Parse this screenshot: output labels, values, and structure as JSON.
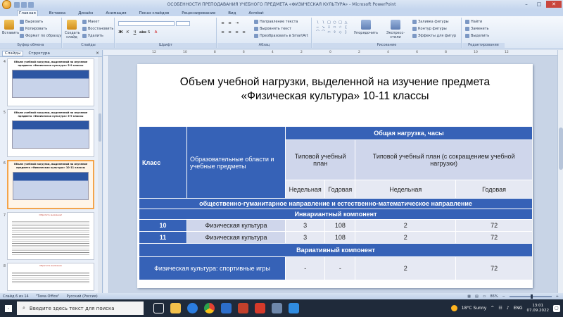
{
  "window": {
    "title": "ОСОБЕННОСТИ ПРЕПОДАВАНИЯ УЧЕБНОГО ПРЕДМЕТА «ФИЗИЧЕСКАЯ КУЛЬТУРА» - Microsoft PowerPoint"
  },
  "ribbon_tabs": [
    "Главная",
    "Вставка",
    "Дизайн",
    "Анимация",
    "Показ слайдов",
    "Рецензирование",
    "Вид",
    "Acrobat"
  ],
  "ribbon": {
    "clipboard": {
      "paste": "Вставить",
      "cut": "Вырезать",
      "copy": "Копировать",
      "format_painter": "Формат по образцу",
      "label": "Буфер обмена"
    },
    "slides": {
      "create": "Создать слайд",
      "layout": "Макет",
      "restore": "Восстановить",
      "delete": "Удалить",
      "label": "Слайды"
    },
    "font": {
      "label": "Шрифт"
    },
    "paragraph": {
      "text_direction": "Направление текста",
      "align_text": "Выровнять текст",
      "smartart": "Преобразовать в SmartArt",
      "label": "Абзац"
    },
    "drawing": {
      "arrange": "Упорядочить",
      "quick_styles": "Экспресс-стили",
      "fill": "Заливка фигуры",
      "outline": "Контур фигуры",
      "effects": "Эффекты для фигур",
      "label": "Рисование"
    },
    "editing": {
      "find": "Найти",
      "replace": "Заменить",
      "select": "Выделить",
      "label": "Редактирование"
    }
  },
  "left_panel": {
    "tab_slides": "Слайды",
    "tab_outline": "Структура",
    "thumbnails": [
      {
        "num": "4",
        "title": "Объем учебной нагрузки, выделенной на изучение предмета «Физическая культура» 5-9 классы"
      },
      {
        "num": "5",
        "title": "Объем учебной нагрузки, выделенной на изучение предмета «Физическая культура» 5-9 классы"
      },
      {
        "num": "6",
        "title": "Объем учебной нагрузки, выделенной на изучение предмета «Физическая культура» 10-11 классы"
      },
      {
        "num": "7",
        "title": "Обратите внимание!"
      },
      {
        "num": "8",
        "title": "Обратите внимание"
      }
    ]
  },
  "slide": {
    "title_line1": "Объем учебной нагрузки, выделенной на изучение предмета",
    "title_line2": "«Физическая культура» 10-11 классы",
    "table": {
      "h_class": "Класс",
      "h_areas": "Образовательные области и учебные предметы",
      "h_total": "Общая нагрузка, часы",
      "h_plan": "Типовой учебный план",
      "h_plan_reduced": "Типовой учебный план (с сокращением учебной нагрузки)",
      "h_weekly1": "Недельная",
      "h_yearly1": "Годовая",
      "h_weekly2": "Недельная",
      "h_yearly2": "Годовая",
      "direction": "общественно-гуманитарное направление и естественно-математическое направление",
      "invariant": "Инвариантный компонент",
      "variative": "Вариативный компонент",
      "rows": [
        {
          "cls": "10",
          "subject": "Физическая культура",
          "w1": "3",
          "y1": "108",
          "w2": "2",
          "y2": "72"
        },
        {
          "cls": "11",
          "subject": "Физическая культура",
          "w1": "3",
          "y1": "108",
          "w2": "2",
          "y2": "72"
        }
      ],
      "var_row": {
        "subject": "Физическая культура: спортивные игры",
        "w1": "-",
        "y1": "-",
        "w2": "2",
        "y2": "72"
      }
    }
  },
  "statusbar": {
    "slide_info": "Слайд 6 из 14",
    "theme": "\"Тема Office\"",
    "language": "Русский (Россия)",
    "zoom": "86%"
  },
  "taskbar": {
    "search_placeholder": "Введите здесь текст для поиска",
    "weather": "18°C Sunny",
    "lang": "ENG",
    "time": "13:01",
    "date": "07.09.2022"
  }
}
